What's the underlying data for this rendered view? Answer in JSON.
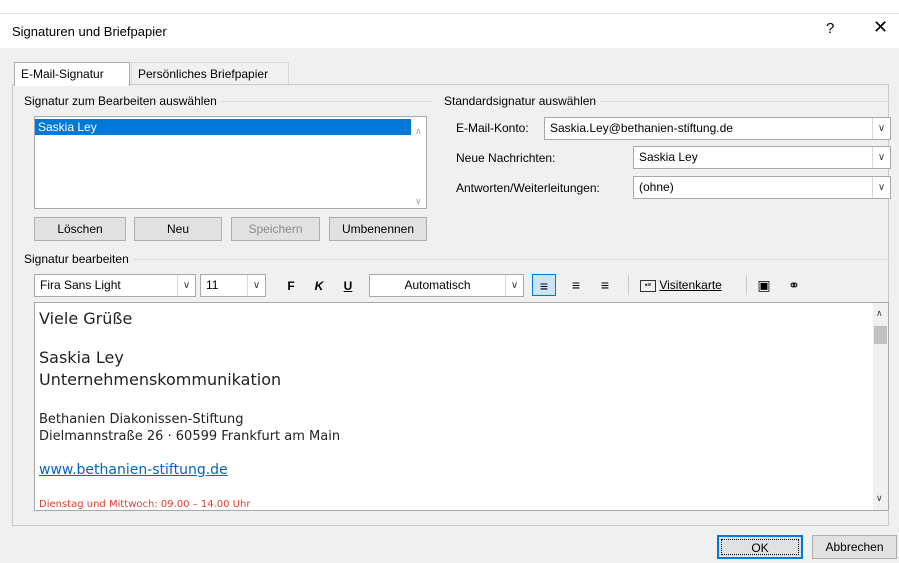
{
  "dialog": {
    "title": "Signaturen und Briefpapier",
    "help": "?",
    "close": "✕"
  },
  "tabs": [
    {
      "label": "E-Mail-Signatur",
      "active": true
    },
    {
      "label": "Persönliches Briefpapier",
      "active": false
    }
  ],
  "select_group": {
    "title": "Signatur zum Bearbeiten auswählen",
    "items": [
      "Saskia Ley"
    ],
    "buttons": {
      "delete": "Löschen",
      "new": "Neu",
      "save": "Speichern",
      "rename": "Umbenennen"
    }
  },
  "default_group": {
    "title": "Standardsignatur auswählen",
    "account_label": "E-Mail-Konto:",
    "account_value": "Saskia.Ley@bethanien-stiftung.de",
    "new_label": "Neue Nachrichten:",
    "new_value": "Saskia Ley",
    "reply_label": "Antworten/Weiterleitungen:",
    "reply_value": "(ohne)"
  },
  "edit_group": {
    "title": "Signatur bearbeiten",
    "font": "Fira Sans Light",
    "size": "11",
    "bold": "F",
    "italic": "K",
    "underline": "U",
    "color": "Automatisch",
    "business_card": "Visitenkarte"
  },
  "signature": {
    "greeting": "Viele Grüße",
    "name": "Saskia Ley",
    "department": "Unternehmenskommunikation",
    "org": "Bethanien Diakonissen-Stiftung",
    "address": "Dielmannstraße 26 · 60599 Frankfurt am Main",
    "website": "www.bethanien-stiftung.de",
    "hours": "Dienstag und Mittwoch: 09.00 – 14.00 Uhr"
  },
  "footer": {
    "ok": "OK",
    "cancel": "Abbrechen"
  },
  "colors": {
    "accent": "#0078d7",
    "link": "#0563c1",
    "hours": "#e03c31"
  }
}
